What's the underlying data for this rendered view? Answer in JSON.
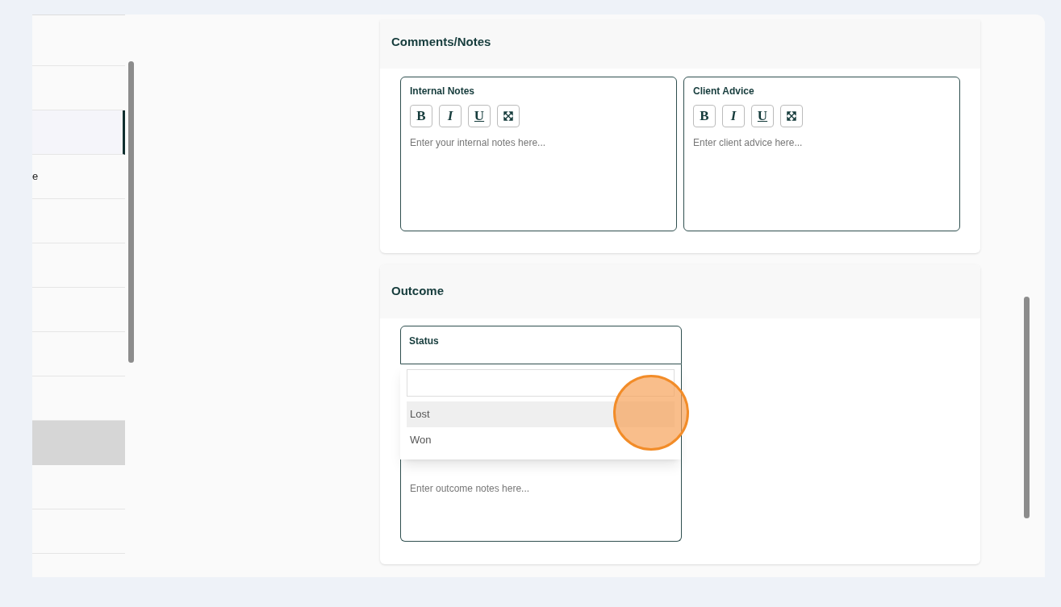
{
  "sidebar": {
    "items": [
      {
        "selected": false,
        "highlighted": false
      },
      {
        "selected": false,
        "highlighted": false
      },
      {
        "selected": true,
        "highlighted": false
      },
      {
        "label": "e",
        "selected": false,
        "highlighted": false
      },
      {
        "selected": false,
        "highlighted": false
      },
      {
        "selected": false,
        "highlighted": false
      },
      {
        "selected": false,
        "highlighted": false
      },
      {
        "selected": false,
        "highlighted": false
      },
      {
        "selected": false,
        "highlighted": false
      },
      {
        "selected": false,
        "highlighted": true
      },
      {
        "selected": false,
        "highlighted": false
      },
      {
        "selected": false,
        "highlighted": false
      }
    ]
  },
  "comments": {
    "title": "Comments/Notes",
    "editors": [
      {
        "label": "Internal Notes",
        "toolbar": [
          "B",
          "I",
          "U"
        ],
        "placeholder": "Enter your internal notes here..."
      },
      {
        "label": "Client Advice",
        "toolbar": [
          "B",
          "I",
          "U"
        ],
        "placeholder": "Enter client advice here..."
      }
    ]
  },
  "outcome": {
    "title": "Outcome",
    "status": {
      "label": "Status",
      "open": true
    },
    "dropdown": {
      "options": [
        {
          "label": "Lost",
          "selected": true
        },
        {
          "label": "Won",
          "selected": false
        }
      ]
    },
    "notes": {
      "placeholder": "Enter outcome notes here..."
    }
  }
}
